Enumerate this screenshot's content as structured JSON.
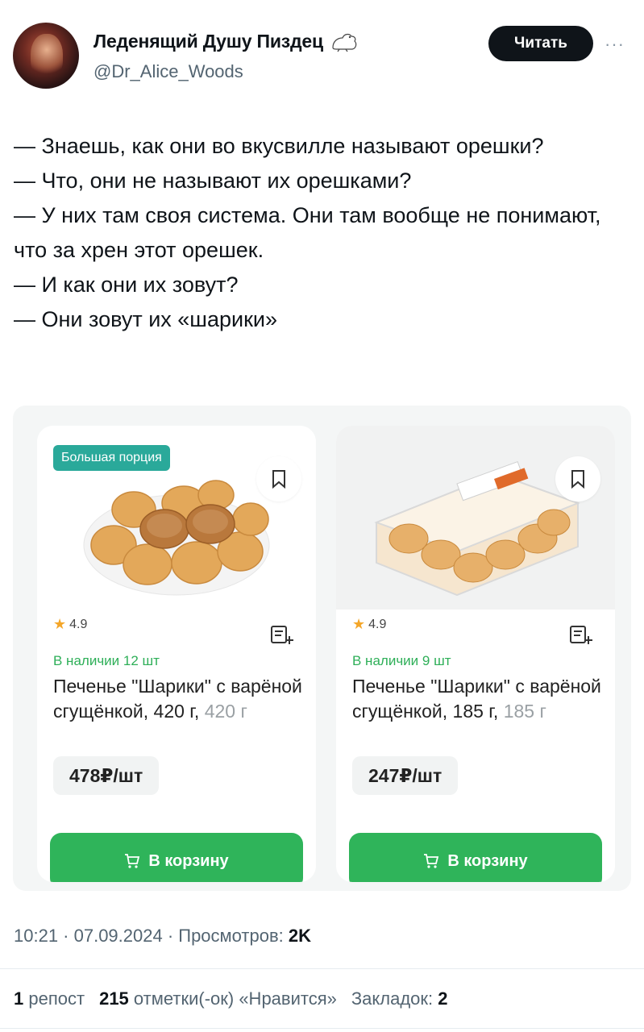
{
  "author": {
    "name": "Леденящий Душу Пиздец",
    "handle": "@Dr_Alice_Woods",
    "follow_label": "Читать"
  },
  "tweet": {
    "lines": [
      "— Знаешь, как они во вкусвилле называют орешки?",
      "— Что, они не называют их орешками?",
      "— У них там своя система. Они там вообще не понимают, что за хрен этот орешек.",
      "— И как они их зовут?",
      "— Они зовут их «шарики»"
    ]
  },
  "products": [
    {
      "badge": "Большая порция",
      "rating": "4.9",
      "stock": "В наличии 12 шт",
      "title": "Печенье \"Шарики\" с варёной сгущёнкой,",
      "weight": "420 г,",
      "weight_muted": "420 г",
      "price": "478₽/шт",
      "cart_label": "В корзину"
    },
    {
      "badge": "",
      "rating": "4.9",
      "stock": "В наличии 9 шт",
      "title": "Печенье \"Шарики\" с варёной сгущёнкой,",
      "weight": "185 г,",
      "weight_muted": "185 г",
      "price": "247₽/шт",
      "cart_label": "В корзину"
    }
  ],
  "meta": {
    "time_date": "10:21 · 07.09.2024 · Просмотров:",
    "views": "2K"
  },
  "stats": {
    "reposts_count": "1",
    "reposts_label": "репост",
    "likes_count": "215",
    "likes_label": "отметки(-ок) «Нравится»",
    "bookmarks_label": "Закладок:",
    "bookmarks_count": "2"
  },
  "colors": {
    "green": "#2fb45a",
    "teal_badge": "#2aa99a",
    "follow_bg": "#0f1419",
    "muted": "#536471"
  }
}
